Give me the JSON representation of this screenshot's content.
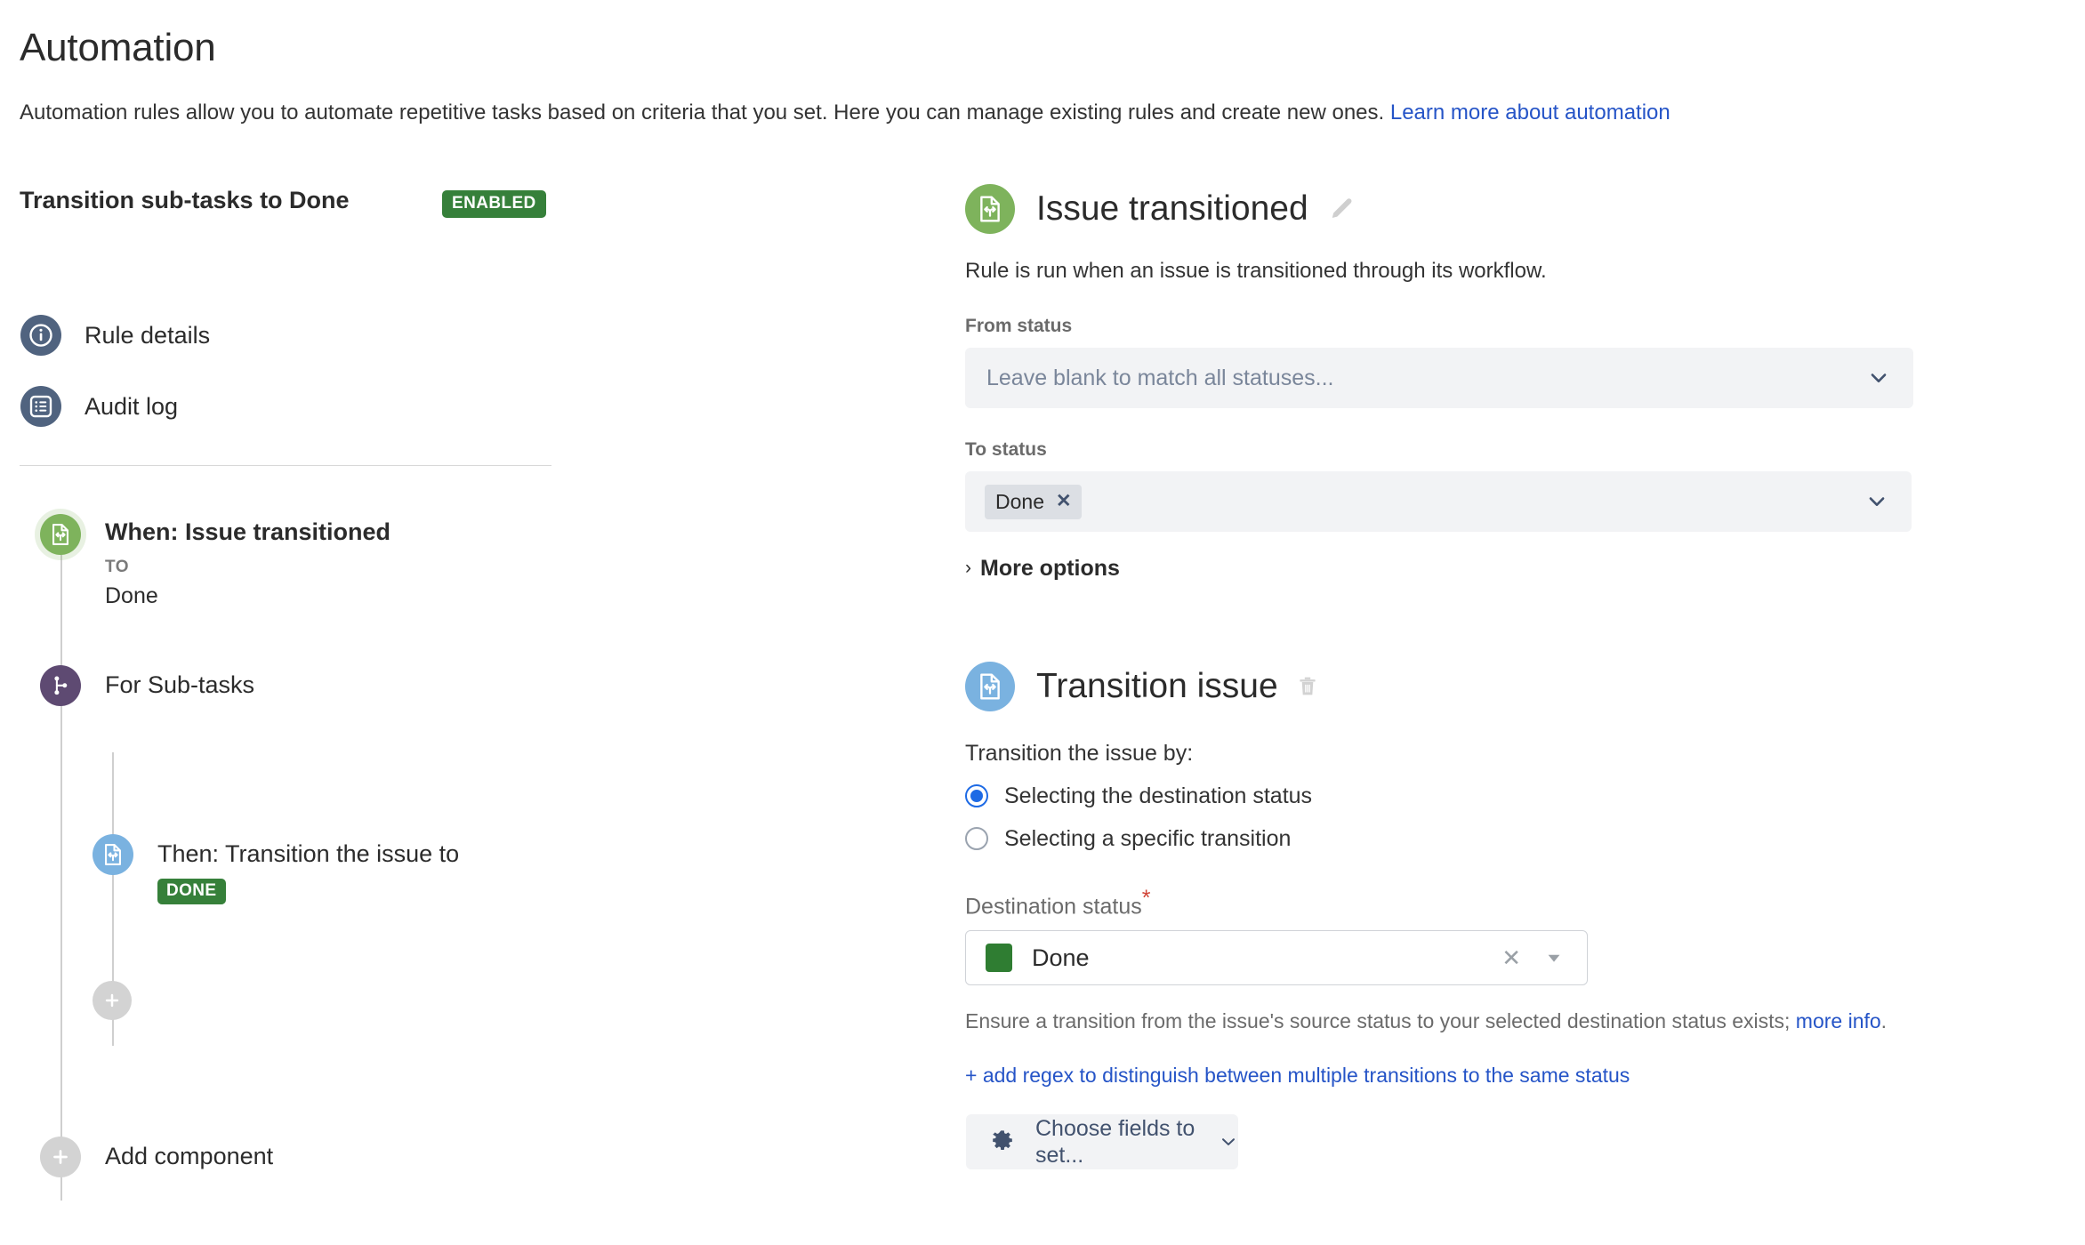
{
  "page": {
    "title": "Automation",
    "subtitle_text": "Automation rules allow you to automate repetitive tasks based on criteria that you set. Here you can manage existing rules and create new ones. ",
    "subtitle_link": "Learn more about automation"
  },
  "rule": {
    "name": "Transition sub-tasks to Done",
    "status_badge": "ENABLED"
  },
  "nav": {
    "items": [
      {
        "label": "Rule details",
        "icon": "info-icon"
      },
      {
        "label": "Audit log",
        "icon": "list-icon"
      }
    ]
  },
  "tree": {
    "trigger": {
      "title": "When: Issue transitioned",
      "sub_label": "TO",
      "sub_value": "Done"
    },
    "branch": {
      "title": "For Sub-tasks"
    },
    "action": {
      "title": "Then: Transition the issue to",
      "chip": "DONE"
    },
    "add_component": {
      "label": "Add component"
    }
  },
  "trigger_panel": {
    "title": "Issue transitioned",
    "edit_icon": "pencil-icon",
    "description": "Rule is run when an issue is transitioned through its workflow.",
    "from_status": {
      "label": "From status",
      "placeholder": "Leave blank to match all statuses..."
    },
    "to_status": {
      "label": "To status",
      "value": "Done",
      "remove": "✕"
    },
    "more_options": "More options",
    "more_options_caret": "›"
  },
  "action_panel": {
    "title": "Transition issue",
    "delete_icon": "trash-icon",
    "transition_by_label": "Transition the issue by:",
    "options": [
      {
        "label": "Selecting the destination status",
        "selected": true
      },
      {
        "label": "Selecting a specific transition",
        "selected": false
      }
    ],
    "destination": {
      "label": "Destination status",
      "required_marker": "*",
      "value": "Done",
      "swatch_color": "#2f7d32",
      "clear": "✕"
    },
    "helper_text": "Ensure a transition from the issue's source status to your selected destination status exists; ",
    "helper_link": "more info",
    "helper_period": ".",
    "regex_link": "+ add regex to distinguish between multiple transitions to the same status",
    "fields_button": {
      "label": "Choose fields to set...",
      "icon": "gear-icon"
    }
  },
  "colors": {
    "accent_link": "#2554C7",
    "badge_green": "#36803A",
    "trigger_green": "#7eb35c",
    "branch_purple": "#5e4a72",
    "action_blue": "#7ab2e0",
    "nav_slate": "#50637f",
    "radio_blue": "#1d6ae5"
  }
}
